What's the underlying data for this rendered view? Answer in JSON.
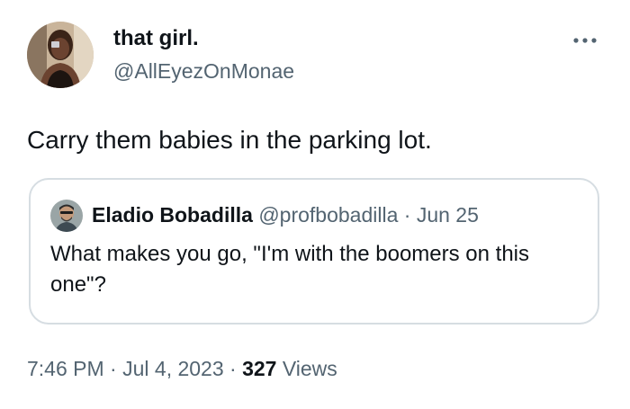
{
  "author": {
    "display_name": "that girl.",
    "handle": "@AllEyezOnMonae",
    "avatar_icon": "profile-photo-avatar"
  },
  "menu_icon": "more-options-icon",
  "tweet_text": "Carry them babies in the parking lot.",
  "quoted_tweet": {
    "display_name": "Eladio Bobadilla",
    "handle": "@profbobadilla",
    "separator": "·",
    "date": "Jun 25",
    "text": "What makes you go, \"I'm with the boomers on this one\"?"
  },
  "meta": {
    "time": "7:46 PM",
    "separator1": "·",
    "date": "Jul 4, 2023",
    "separator2": "·",
    "views_count": "327",
    "views_label": "Views"
  },
  "colors": {
    "primary_text": "#0f1419",
    "secondary_text": "#536471",
    "border": "#d6dde2",
    "background": "#ffffff"
  }
}
